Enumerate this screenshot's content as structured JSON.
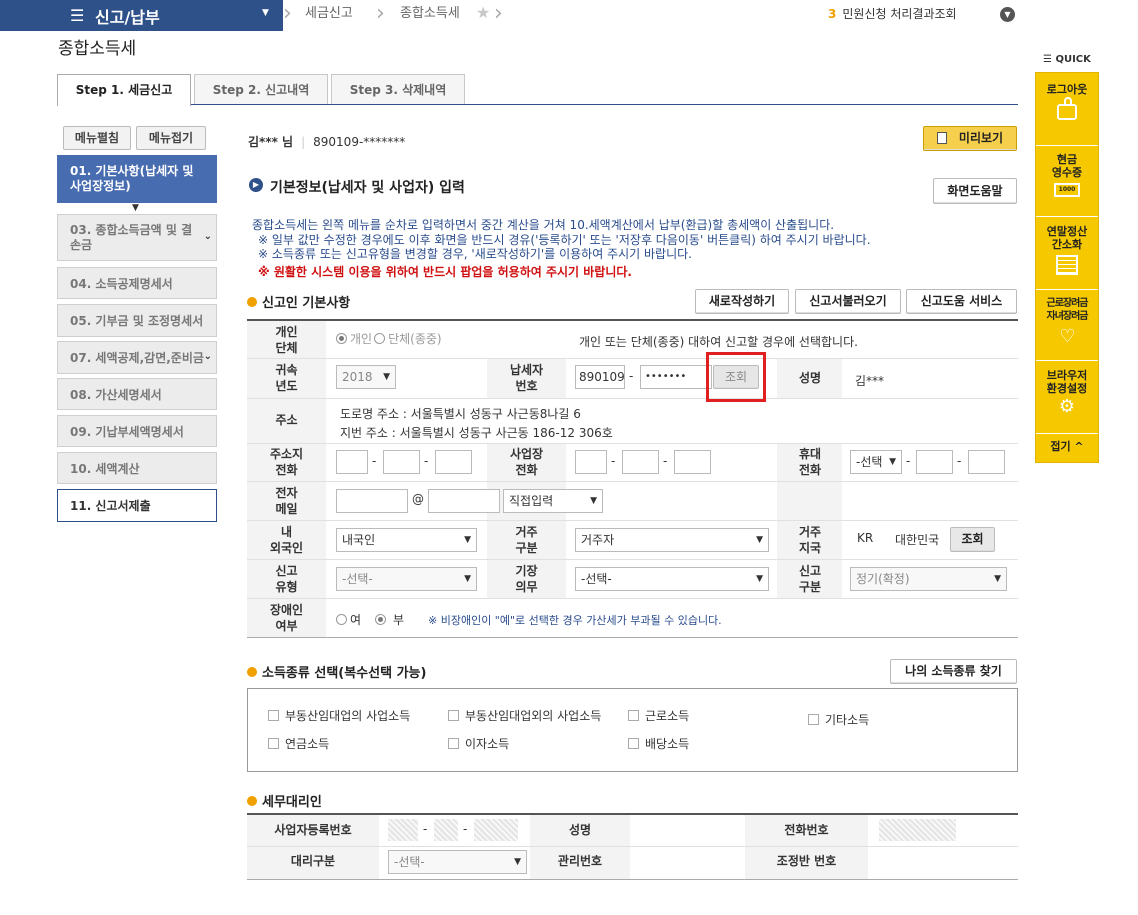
{
  "topnav": {
    "menu_title": "신고/납부",
    "crumb1": "세금신고",
    "crumb2": "종합소득세",
    "notice_count": "3",
    "notice_label": "민원신청 처리결과조회"
  },
  "page_title": "종합소득세",
  "tabs": [
    "Step 1. 세금신고",
    "Step 2. 신고내역",
    "Step 3. 삭제내역"
  ],
  "left": {
    "expand": "메뉴펼침",
    "collapse": "메뉴접기",
    "items": [
      "01. 기본사항(납세자 및 사업장정보)",
      "03. 종합소득금액 및 결손금",
      "04. 소득공제명세서",
      "05. 기부금 및 조정명세서",
      "07. 세액공제,감면,준비금",
      "08. 가산세명세서",
      "09. 기납부세액명세서",
      "10. 세액계산",
      "11. 신고서제출"
    ]
  },
  "user": {
    "name": "김*** 님",
    "id": "890109-*******",
    "preview": "미리보기"
  },
  "section_title": "기본정보(납세자 및 사업자) 입력",
  "help_btn": "화면도움말",
  "info": {
    "l1": "종합소득세는 왼쪽 메뉴를 순차로 입력하면서 중간 계산을 거쳐 10.세액계산에서 납부(환급)할 총세액이 산출됩니다.",
    "l2": "※ 일부 값만 수정한 경우에도 이후 화면을 반드시 경유('등록하기' 또는 '저장후 다음이동' 버튼클릭) 하여 주시기 바랍니다.",
    "l3": "※ 소득종류 또는 신고유형을 변경할 경우, '새로작성하기'를 이용하여 주시기 바랍니다.",
    "l4": "※ 원활한 시스템 이용을 위하여 반드시 팝업을 허용하여 주시기 바랍니다."
  },
  "reporter": {
    "title": "신고인 기본사항",
    "btn_new": "새로작성하기",
    "btn_load": "신고서불러오기",
    "btn_help": "신고도움 서비스",
    "type_label": "개인\n단체",
    "opt_person": "개인",
    "opt_group": "단체(종중)",
    "type_desc": "개인 또는 단체(종중) 대하여 신고할 경우에 선택합니다.",
    "year_label": "귀속\n년도",
    "year": "2018",
    "taxno_label": "납세자\n번호",
    "taxno1": "890109",
    "taxno2": "•••••••",
    "lookup": "조회",
    "name_label": "성명",
    "name": "김***",
    "addr_label": "주소",
    "road": "도로명 주소 :  서울특별시 성동구 사근동8나길 6",
    "jibun": "지번 주소 :  서울특별시 성동구 사근동 186-12 306호",
    "home_tel_label": "주소지\n전화",
    "biz_tel_label": "사업장\n전화",
    "mobile_label": "휴대\n전화",
    "mobile_sel": "-선택",
    "email_label": "전자\n메일",
    "email_sel": "직접입력",
    "nat_label": "내\n외국인",
    "nat": "내국인",
    "res_label": "거주\n구분",
    "res": "거주자",
    "country_label": "거주\n지국",
    "country_code": "KR",
    "country_name": "대한민국",
    "country_lookup": "조회",
    "rtype_label": "신고\n유형",
    "rtype": "-선택-",
    "book_label": "기장\n의무",
    "book": "-선택-",
    "rkind_label": "신고\n구분",
    "rkind": "정기(확정)",
    "dis_label": "장애인\n여부",
    "dis_yes": "여",
    "dis_no": "부",
    "dis_note": "※ 비장애인이 \"예\"로 선택한 경우 가산세가 부과될 수 있습니다."
  },
  "income": {
    "title": "소득종류 선택(복수선택 가능)",
    "find_btn": "나의 소득종류 찾기",
    "items": [
      "부동산임대업의 사업소득",
      "부동산임대업외의 사업소득",
      "근로소득",
      "기타소득",
      "연금소득",
      "이자소득",
      "배당소득"
    ]
  },
  "agent": {
    "title": "세무대리인",
    "bizno_label": "사업자등록번호",
    "name_label": "성명",
    "tel_label": "전화번호",
    "type_label": "대리구분",
    "type_sel": "-선택-",
    "mgmt_label": "관리번호",
    "adj_label": "조정반 번호"
  },
  "quick": {
    "title": "QUICK",
    "logout": "로그아웃",
    "receipt": "현금\n영수증",
    "yearend": "연말정산\n간소화",
    "eitc": "근로장려금\n자녀장려금",
    "browser": "브라우저\n환경설정",
    "fold": "접기"
  },
  "colors": {
    "nav": "#2e5189",
    "accent": "#f0a000",
    "quick": "#f5c800",
    "highlight": "#e02020",
    "info_text": "#2a4c8c",
    "warn_text": "#d01010"
  }
}
